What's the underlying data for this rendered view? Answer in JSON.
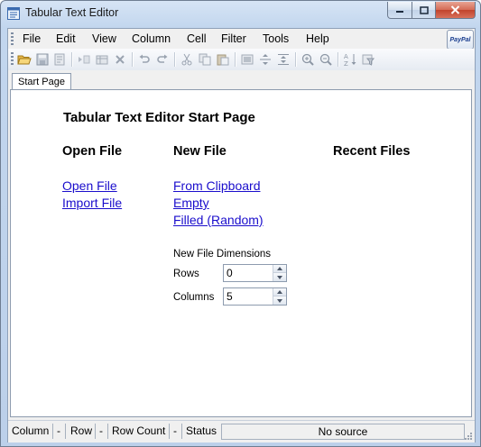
{
  "window": {
    "title": "Tabular Text Editor",
    "caption_min": "—",
    "caption_max": "▫",
    "caption_close": "✕"
  },
  "menu": {
    "items": [
      "File",
      "Edit",
      "View",
      "Column",
      "Cell",
      "Filter",
      "Tools",
      "Help"
    ],
    "paypal_label": "PayPal"
  },
  "toolbar": {
    "icons": [
      "open-folder-icon",
      "save-icon",
      "save-as-icon",
      "insert-icon",
      "table-icon",
      "delete-icon",
      "undo-icon",
      "redo-icon",
      "cut-icon",
      "copy-icon",
      "paste-icon",
      "align-icon",
      "row-height-icon",
      "column-width-icon",
      "zoom-in-icon",
      "zoom-out-icon",
      "sort-az-icon",
      "filter-icon"
    ]
  },
  "tabs": [
    "Start Page"
  ],
  "start_page": {
    "title": "Tabular Text Editor Start Page",
    "open_file": {
      "heading": "Open File",
      "links": [
        "Open File",
        "Import File"
      ]
    },
    "new_file": {
      "heading": "New File",
      "links": [
        "From Clipboard",
        "Empty",
        "Filled (Random)"
      ],
      "dimensions_label": "New File Dimensions",
      "rows_label": "Rows",
      "rows_value": "0",
      "columns_label": "Columns",
      "columns_value": "5"
    },
    "recent_files": {
      "heading": "Recent Files"
    }
  },
  "status": {
    "column_label": "Column",
    "column_value": "-",
    "row_label": "Row",
    "row_value": "-",
    "row_count_label": "Row Count",
    "row_count_value": "-",
    "status_label": "Status",
    "source": "No source"
  },
  "colors": {
    "link": "#1a0dcc",
    "chrome": "#c2d6ee",
    "close": "#c1432c"
  }
}
